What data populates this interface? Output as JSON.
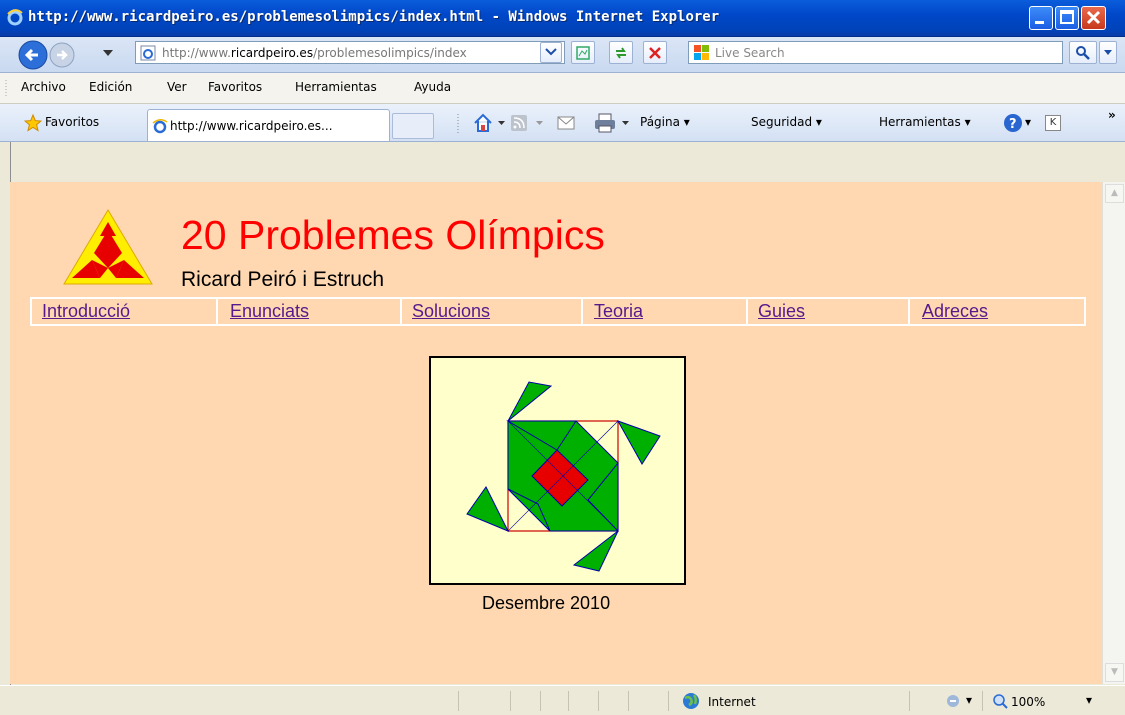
{
  "window": {
    "title": "http://www.ricardpeiro.es/problemesolimpics/index.html - Windows Internet Explorer"
  },
  "nav": {
    "address_prefix": "http://www.",
    "address_domain": "ricardpeiro.es",
    "address_path": "/problemesolimpics/index",
    "search_placeholder": "Live Search"
  },
  "menu": {
    "items": [
      "Archivo",
      "Edición",
      "Ver",
      "Favoritos",
      "Herramientas",
      "Ayuda"
    ]
  },
  "favbar": {
    "favorites_label": "Favoritos",
    "tab_label": "http://www.ricardpeiro.es...",
    "page_label": "Página",
    "security_label": "Seguridad",
    "tools_label": "Herramientas",
    "k_label": "K"
  },
  "page": {
    "title": "20 Problemes Olímpics",
    "author": "Ricard Peiró i Estruch",
    "nav_links": [
      "Introducció",
      "Enunciats",
      "Solucions",
      "Teoria",
      "Guies",
      "Adreces"
    ],
    "caption": "Desembre 2010"
  },
  "status": {
    "zone": "Internet",
    "zoom": "100%"
  },
  "colors": {
    "title_red": "#ff0000",
    "page_bg": "#ffd8b2",
    "figure_bg": "#ffffcc",
    "link": "#551a8b",
    "green": "#00b000",
    "logo_yellow": "#ffee00"
  }
}
